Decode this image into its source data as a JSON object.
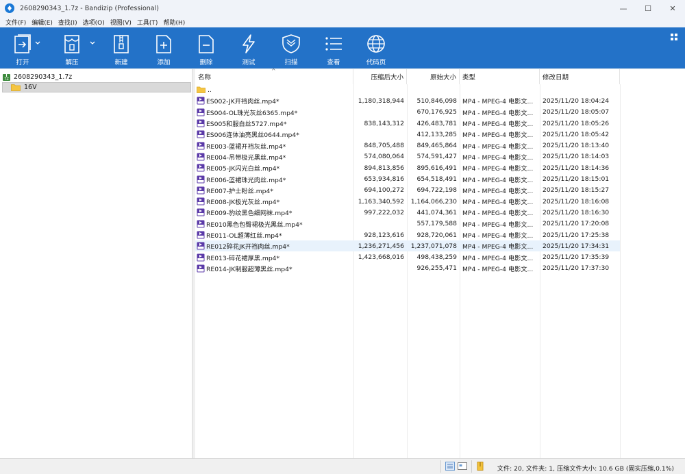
{
  "window": {
    "title": "2608290343_1.7z - Bandizip (Professional)",
    "controls": [
      "—",
      "☐",
      "✕"
    ]
  },
  "menu": [
    "文件(F)",
    "编辑(E)",
    "查找(I)",
    "选项(O)",
    "视图(V)",
    "工具(T)",
    "帮助(H)"
  ],
  "toolbar": {
    "open": "打开",
    "extract": "解压",
    "new": "新建",
    "add": "添加",
    "delete": "删除",
    "test": "测试",
    "scan": "扫描",
    "view": "查看",
    "codepage": "代码页"
  },
  "tree": {
    "root": "2608290343_1.7z",
    "child": "16V"
  },
  "columns": {
    "name": "名称",
    "packed": "压缩后大小",
    "size": "原始大小",
    "type": "类型",
    "modified": "修改日期"
  },
  "parent_entry": "..",
  "files": [
    {
      "name": "ES002-JK开裆肉丝.mp4*",
      "packed": "1,180,318,944",
      "size": "510,846,098",
      "type": "MP4 - MPEG-4 电影文...",
      "modified": "2025/11/20 18:04:24"
    },
    {
      "name": "ES004-OL珠光灰丝6365.mp4*",
      "packed": "",
      "size": "670,176,925",
      "type": "MP4 - MPEG-4 电影文...",
      "modified": "2025/11/20 18:05:07"
    },
    {
      "name": "ES005和服白丝5727.mp4*",
      "packed": "838,143,312",
      "size": "426,483,781",
      "type": "MP4 - MPEG-4 电影文...",
      "modified": "2025/11/20 18:05:26"
    },
    {
      "name": "ES006连体油亮黑丝0644.mp4*",
      "packed": "",
      "size": "412,133,285",
      "type": "MP4 - MPEG-4 电影文...",
      "modified": "2025/11/20 18:05:42"
    },
    {
      "name": "RE003-蓝裙开裆灰丝.mp4*",
      "packed": "848,705,488",
      "size": "849,465,864",
      "type": "MP4 - MPEG-4 电影文...",
      "modified": "2025/11/20 18:13:40"
    },
    {
      "name": "RE004-吊带极光黑丝.mp4*",
      "packed": "574,080,064",
      "size": "574,591,427",
      "type": "MP4 - MPEG-4 电影文...",
      "modified": "2025/11/20 18:14:03"
    },
    {
      "name": "RE005-JK闪光白丝.mp4*",
      "packed": "894,813,856",
      "size": "895,616,491",
      "type": "MP4 - MPEG-4 电影文...",
      "modified": "2025/11/20 18:14:36"
    },
    {
      "name": "RE006-蓝裙珠光肉丝.mp4*",
      "packed": "653,934,816",
      "size": "654,518,491",
      "type": "MP4 - MPEG-4 电影文...",
      "modified": "2025/11/20 18:15:01"
    },
    {
      "name": "RE007-护士粉丝.mp4*",
      "packed": "694,100,272",
      "size": "694,722,198",
      "type": "MP4 - MPEG-4 电影文...",
      "modified": "2025/11/20 18:15:27"
    },
    {
      "name": "RE008-JK极光灰丝.mp4*",
      "packed": "1,163,340,592",
      "size": "1,164,066,230",
      "type": "MP4 - MPEG-4 电影文...",
      "modified": "2025/11/20 18:16:08"
    },
    {
      "name": "RE009-豹纹黑色细网袜.mp4*",
      "packed": "997,222,032",
      "size": "441,074,361",
      "type": "MP4 - MPEG-4 电影文...",
      "modified": "2025/11/20 18:16:30"
    },
    {
      "name": "RE010黑色包臀裙极光黑丝.mp4*",
      "packed": "",
      "size": "557,179,588",
      "type": "MP4 - MPEG-4 电影文...",
      "modified": "2025/11/20 17:20:08"
    },
    {
      "name": "RE011-OL超薄红丝.mp4*",
      "packed": "928,123,616",
      "size": "928,720,061",
      "type": "MP4 - MPEG-4 电影文...",
      "modified": "2025/11/20 17:25:38"
    },
    {
      "name": "RE012碎花JK开裆肉丝.mp4*",
      "packed": "1,236,271,456",
      "size": "1,237,071,078",
      "type": "MP4 - MPEG-4 电影文...",
      "modified": "2025/11/20 17:34:31"
    },
    {
      "name": "RE013-碎花裙厚黑.mp4*",
      "packed": "1,423,668,016",
      "size": "498,438,259",
      "type": "MP4 - MPEG-4 电影文...",
      "modified": "2025/11/20 17:35:39"
    },
    {
      "name": "RE014-JK制服超薄黑丝.mp4*",
      "packed": "",
      "size": "926,255,471",
      "type": "MP4 - MPEG-4 电影文...",
      "modified": "2025/11/20 17:37:30"
    }
  ],
  "selected_row": 13,
  "status": "文件: 20, 文件夹: 1, 压缩文件大小: 10.6 GB (固实压缩,0.1%)",
  "colors": {
    "toolbar": "#2372c8",
    "selection": "#e8f2fc",
    "video_icon": "#5b3aa8"
  }
}
